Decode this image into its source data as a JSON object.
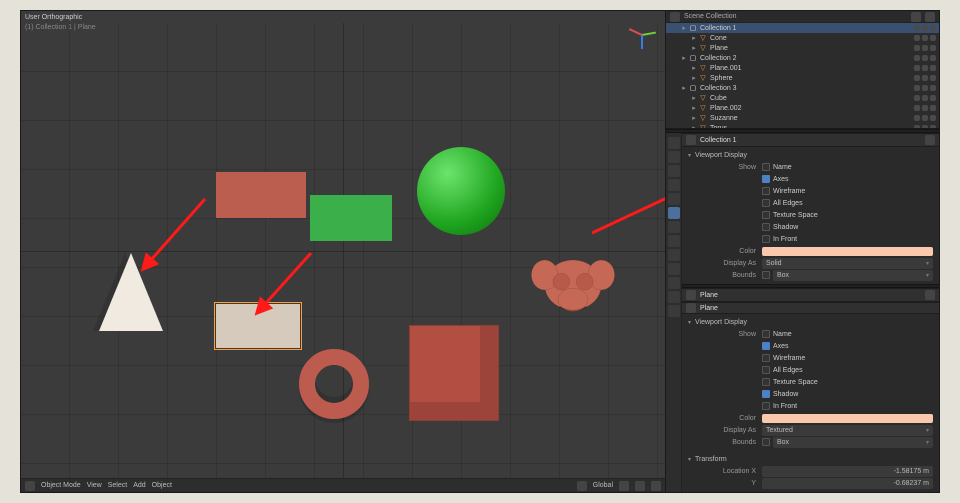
{
  "viewport": {
    "title": "User Orthographic",
    "subtitle": "(1) Collection 1 | Plane",
    "footer_left": [
      "Object Mode",
      "View",
      "Select",
      "Add",
      "Object"
    ],
    "footer_right": [
      "Global"
    ]
  },
  "outliner": {
    "root": "Scene Collection",
    "tree": [
      {
        "label": "Collection 1",
        "type": "collection",
        "depth": 1,
        "selected": true
      },
      {
        "label": "Cone",
        "type": "mesh",
        "depth": 2
      },
      {
        "label": "Plane",
        "type": "mesh",
        "depth": 2
      },
      {
        "label": "Collection 2",
        "type": "collection",
        "depth": 1
      },
      {
        "label": "Plane.001",
        "type": "mesh",
        "depth": 2
      },
      {
        "label": "Sphere",
        "type": "mesh",
        "depth": 2
      },
      {
        "label": "Collection 3",
        "type": "collection",
        "depth": 1
      },
      {
        "label": "Cube",
        "type": "mesh",
        "depth": 2
      },
      {
        "label": "Plane.002",
        "type": "mesh",
        "depth": 2
      },
      {
        "label": "Suzanne",
        "type": "mesh",
        "depth": 2
      },
      {
        "label": "Torus",
        "type": "mesh",
        "depth": 2
      }
    ]
  },
  "props_top": {
    "context": "Collection 1",
    "section": "Viewport Display",
    "items": [
      {
        "label": "Show",
        "sub": "Name",
        "checked": false
      },
      {
        "label": "",
        "sub": "Axes",
        "checked": true
      },
      {
        "label": "",
        "sub": "Wireframe",
        "checked": false
      },
      {
        "label": "",
        "sub": "All Edges",
        "checked": false
      },
      {
        "label": "",
        "sub": "Texture Space",
        "checked": false
      },
      {
        "label": "",
        "sub": "Shadow",
        "checked": false
      },
      {
        "label": "",
        "sub": "In Front",
        "checked": false
      }
    ],
    "color": "#f9c8ad",
    "display_as": "Solid",
    "bounds": "Box"
  },
  "props_bottom": {
    "context": "Plane",
    "breadcrumb": "Plane",
    "section": "Viewport Display",
    "items": [
      {
        "label": "Show",
        "sub": "Name",
        "checked": false
      },
      {
        "label": "",
        "sub": "Axes",
        "checked": true
      },
      {
        "label": "",
        "sub": "Wireframe",
        "checked": false
      },
      {
        "label": "",
        "sub": "All Edges",
        "checked": false
      },
      {
        "label": "",
        "sub": "Texture Space",
        "checked": false
      },
      {
        "label": "",
        "sub": "Shadow",
        "checked": true
      },
      {
        "label": "",
        "sub": "In Front",
        "checked": false
      }
    ],
    "color": "#f9c8ad",
    "display_as": "Textured",
    "bounds": "Box",
    "transform_section": "Transform",
    "location_x": "-1.58175 m",
    "location_y": "-0.68237 m"
  }
}
